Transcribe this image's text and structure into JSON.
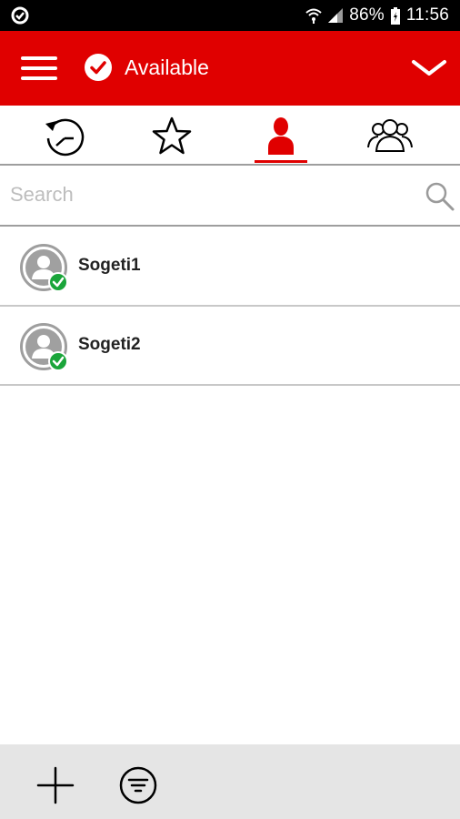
{
  "status_bar": {
    "battery": "86%",
    "time": "11:56",
    "icons": [
      "app-notification-icon",
      "wifi-icon",
      "signal-icon",
      "battery-icon"
    ]
  },
  "app_bar": {
    "presence_status": "Available",
    "accent_color": "#e00000",
    "status_color": "#ffffff",
    "icons": [
      "hamburger-menu-icon",
      "available-check-icon",
      "chevron-down-icon"
    ]
  },
  "tabs": {
    "items": [
      {
        "icon": "recent-history-icon",
        "active": false
      },
      {
        "icon": "favorites-star-icon",
        "active": false
      },
      {
        "icon": "contact-person-icon",
        "active": true
      },
      {
        "icon": "groups-icon",
        "active": false
      }
    ]
  },
  "search": {
    "placeholder": "Search",
    "value": ""
  },
  "contacts": [
    {
      "name": "Sogeti1",
      "status": "available"
    },
    {
      "name": "Sogeti2",
      "status": "available"
    }
  ],
  "bottom_bar": {
    "icons": [
      "add-plus-icon",
      "filter-icon"
    ]
  }
}
